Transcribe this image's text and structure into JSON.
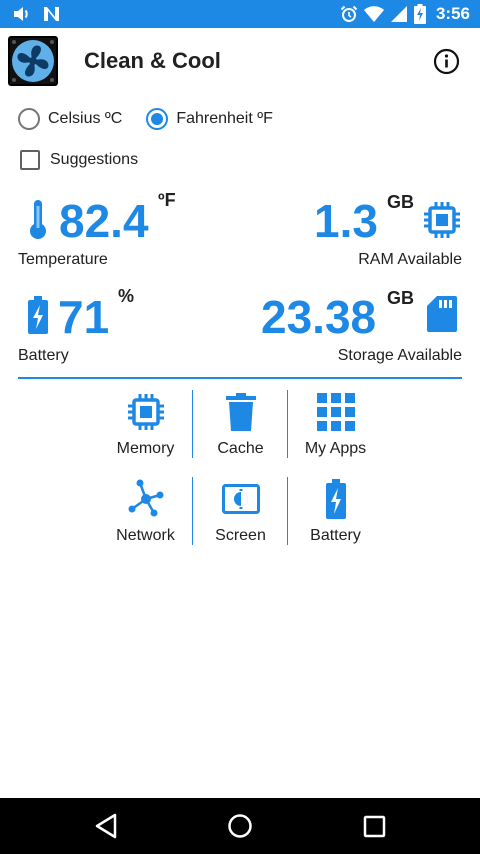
{
  "status_bar": {
    "time": "3:56",
    "left_icons": [
      "volume-icon",
      "notification-n-icon"
    ],
    "right_icons": [
      "alarm-icon",
      "wifi-icon",
      "signal-icon",
      "battery-charging-icon"
    ]
  },
  "app": {
    "title": "Clean & Cool",
    "logo_icon": "fan-logo-icon",
    "info_icon": "info-icon"
  },
  "units": {
    "options": [
      "Celsius ºC",
      "Fahrenheit ºF"
    ],
    "selected": "Fahrenheit ºF"
  },
  "suggestions": {
    "label": "Suggestions",
    "checked": false
  },
  "stats": {
    "temperature": {
      "value": "82.4",
      "unit": "ºF",
      "label": "Temperature",
      "icon": "thermometer-icon"
    },
    "ram": {
      "value": "1.3",
      "unit": "GB",
      "label": "RAM Available",
      "icon": "chip-icon"
    },
    "battery": {
      "value": "71",
      "unit": "%",
      "label": "Battery",
      "icon": "battery-charging-icon"
    },
    "storage": {
      "value": "23.38",
      "unit": "GB",
      "label": "Storage Available",
      "icon": "sd-card-icon"
    }
  },
  "tools": [
    {
      "label": "Memory",
      "icon": "chip-icon"
    },
    {
      "label": "Cache",
      "icon": "trash-icon"
    },
    {
      "label": "My Apps",
      "icon": "apps-grid-icon"
    },
    {
      "label": "Network",
      "icon": "network-icon"
    },
    {
      "label": "Screen",
      "icon": "screen-brightness-icon"
    },
    {
      "label": "Battery",
      "icon": "battery-charging-icon"
    }
  ],
  "nav_bar": {
    "buttons": [
      "back-icon",
      "home-icon",
      "recents-icon"
    ]
  },
  "colors": {
    "accent": "#1e88e5",
    "text": "#212121",
    "nav_bar": "#000000"
  }
}
